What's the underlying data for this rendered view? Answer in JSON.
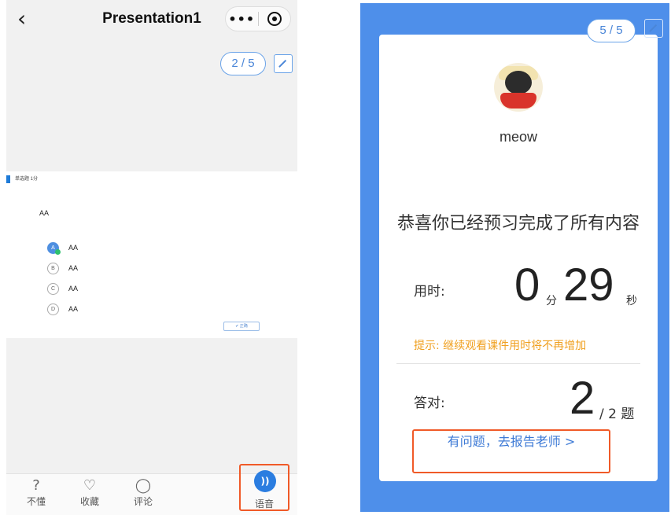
{
  "left": {
    "title": "Presentation1",
    "back_icon": "chevron-left-icon",
    "more_glyph": "•••",
    "pager": "2 / 5",
    "slide": {
      "tag": "单选题 1分",
      "question": "AA",
      "options": [
        {
          "letter": "A",
          "text": "AA",
          "selected": true
        },
        {
          "letter": "B",
          "text": "AA",
          "selected": false
        },
        {
          "letter": "C",
          "text": "AA",
          "selected": false
        },
        {
          "letter": "D",
          "text": "AA",
          "selected": false
        }
      ],
      "correct_label": "✔ 正确"
    },
    "tabs": {
      "dontknow": {
        "icon": "question-icon",
        "glyph": "?",
        "label": "不懂"
      },
      "favorite": {
        "icon": "heart-icon",
        "glyph": "♡",
        "label": "收藏"
      },
      "comment": {
        "icon": "comment-icon",
        "glyph": "◯",
        "label": "评论"
      },
      "voice": {
        "icon": "voice-icon",
        "glyph": "))",
        "label": "语音"
      }
    }
  },
  "right": {
    "pager": "5 / 5",
    "username": "meow",
    "congrats": "恭喜你已经预习完成了所有内容",
    "time_label": "用时:",
    "minutes": "0",
    "minutes_unit": "分",
    "seconds": "29",
    "seconds_unit": "秒",
    "tip": "提示: 继续观看课件用时将不再增加",
    "correct_label": "答对:",
    "correct_count": "2",
    "total": "/ 2 题",
    "report_button": "有问题，去报告老师 >"
  },
  "colors": {
    "accent": "#4e8fea",
    "highlight": "#f05a28",
    "tip": "#f0a020"
  }
}
